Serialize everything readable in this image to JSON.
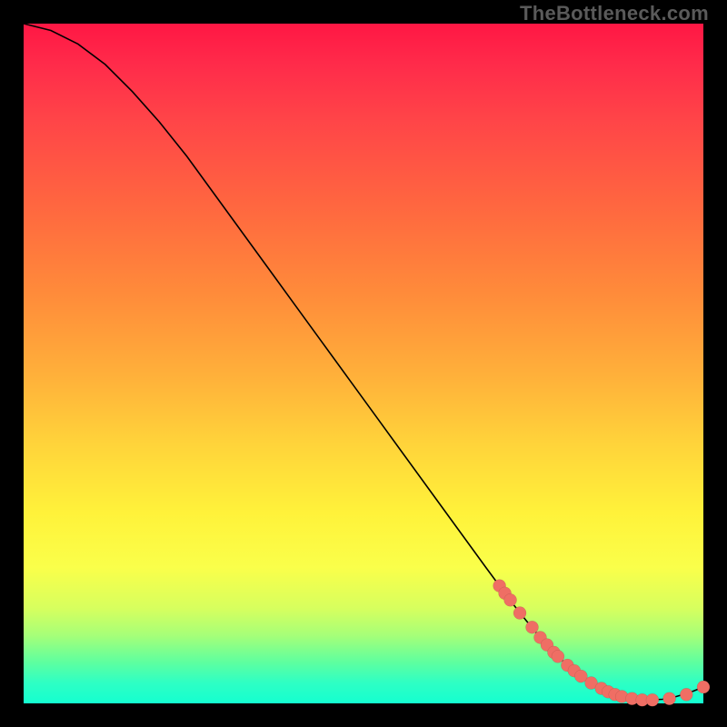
{
  "watermark": "TheBottleneck.com",
  "chart_data": {
    "type": "line",
    "title": "",
    "xlabel": "",
    "ylabel": "",
    "xlim": [
      0,
      100
    ],
    "ylim": [
      0,
      100
    ],
    "grid": false,
    "legend": false,
    "background_gradient": {
      "top": "#ff1744",
      "upper_mid": "#ffb13a",
      "lower_mid": "#fff23a",
      "bottom": "#14ffd0"
    },
    "series": [
      {
        "name": "bottleneck-curve",
        "x": [
          0,
          4,
          8,
          12,
          16,
          20,
          24,
          28,
          32,
          36,
          40,
          44,
          48,
          52,
          56,
          60,
          64,
          68,
          70,
          72,
          74,
          76,
          78,
          80,
          82,
          84,
          86,
          88,
          90,
          92,
          94,
          96,
          98,
          100
        ],
        "values": [
          100,
          99,
          97,
          94,
          90,
          85.5,
          80.5,
          75,
          69.5,
          64,
          58.5,
          53,
          47.5,
          42,
          36.5,
          31,
          25.5,
          20,
          17.3,
          14.6,
          12.1,
          9.7,
          7.5,
          5.6,
          4.0,
          2.7,
          1.7,
          1.0,
          0.6,
          0.5,
          0.6,
          1.0,
          1.6,
          2.4
        ]
      }
    ],
    "markers": {
      "name": "highlight-dots",
      "color": "#ef6e64",
      "points": [
        {
          "x": 70.0,
          "y": 17.3
        },
        {
          "x": 70.8,
          "y": 16.2
        },
        {
          "x": 71.6,
          "y": 15.2
        },
        {
          "x": 73.0,
          "y": 13.3
        },
        {
          "x": 74.8,
          "y": 11.2
        },
        {
          "x": 76.0,
          "y": 9.7
        },
        {
          "x": 77.0,
          "y": 8.6
        },
        {
          "x": 78.0,
          "y": 7.5
        },
        {
          "x": 78.6,
          "y": 6.9
        },
        {
          "x": 80.0,
          "y": 5.6
        },
        {
          "x": 81.0,
          "y": 4.8
        },
        {
          "x": 82.0,
          "y": 4.0
        },
        {
          "x": 83.5,
          "y": 3.0
        },
        {
          "x": 85.0,
          "y": 2.2
        },
        {
          "x": 86.0,
          "y": 1.7
        },
        {
          "x": 87.0,
          "y": 1.3
        },
        {
          "x": 88.0,
          "y": 1.0
        },
        {
          "x": 89.5,
          "y": 0.7
        },
        {
          "x": 91.0,
          "y": 0.5
        },
        {
          "x": 92.5,
          "y": 0.5
        },
        {
          "x": 95.0,
          "y": 0.7
        },
        {
          "x": 97.5,
          "y": 1.3
        },
        {
          "x": 100.0,
          "y": 2.4
        }
      ]
    }
  }
}
